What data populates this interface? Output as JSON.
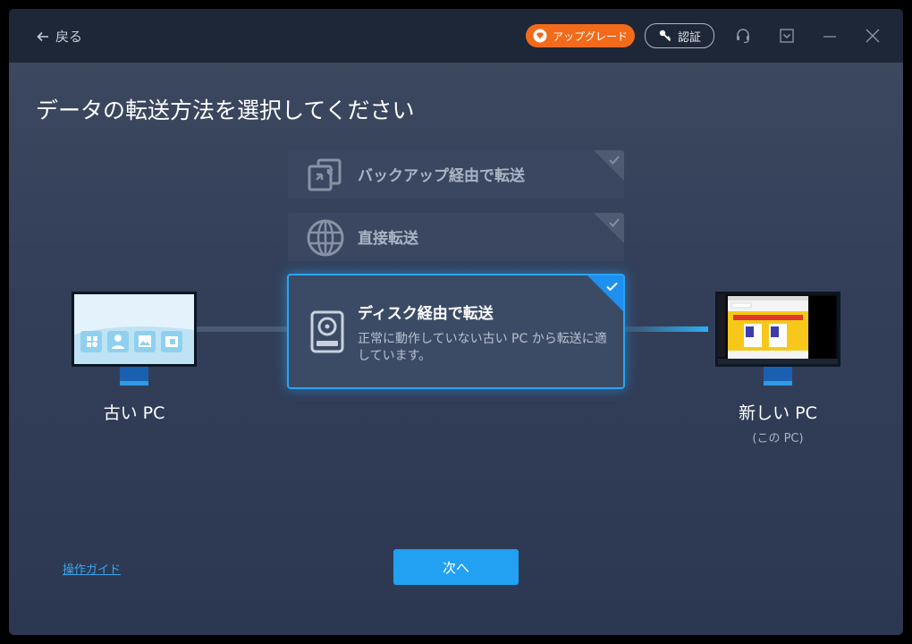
{
  "header": {
    "back_label": "戻る",
    "upgrade_label": "アップグレード",
    "activate_label": "認証"
  },
  "page_title": "データの転送方法を選択してください",
  "options": [
    {
      "label": "バックアップ経由で転送",
      "icon": "backup-transfer-icon",
      "selected": false
    },
    {
      "label": "直接転送",
      "icon": "globe-network-icon",
      "selected": false
    },
    {
      "label": "ディスク経由で転送",
      "description": "正常に動作していない古い PC から転送に適しています。",
      "icon": "disk-drive-icon",
      "selected": true
    }
  ],
  "old_pc": {
    "label": "古い PC"
  },
  "new_pc": {
    "label": "新しい PC",
    "sublabel": "(この PC)"
  },
  "footer": {
    "guide_link": "操作ガイド",
    "next_label": "次へ"
  },
  "colors": {
    "accent": "#22a0f2",
    "upgrade": "#f26a1a",
    "titlebar": "#1e2737",
    "background": "#34405a"
  }
}
